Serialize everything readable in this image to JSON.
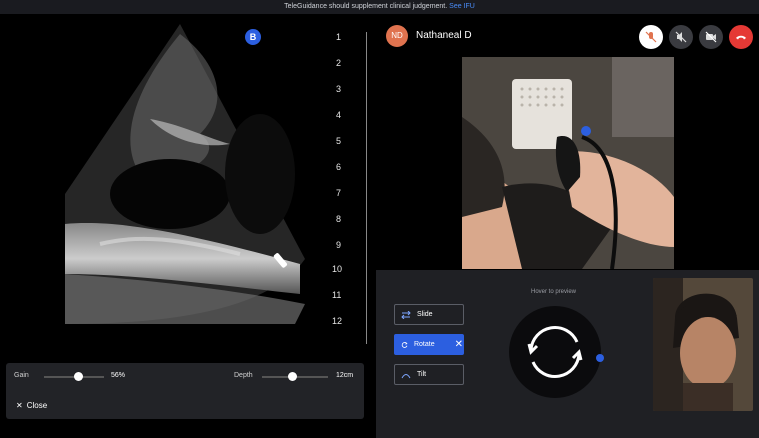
{
  "banner": {
    "text": "TeleGuidance should supplement clinical judgement.",
    "link": "See IFU"
  },
  "ultrasound": {
    "marker_label": "B",
    "depth_ticks": [
      "1",
      "2",
      "3",
      "4",
      "5",
      "6",
      "7",
      "8",
      "9",
      "10",
      "11",
      "12"
    ],
    "gain": {
      "label": "Gain",
      "value": "56%",
      "level": 0.56
    },
    "depth": {
      "label": "Depth",
      "value": "12cm",
      "level": 0.45
    },
    "close_label": "Close"
  },
  "call": {
    "avatar_initials": "ND",
    "caller_name": "Nathaneal D",
    "accent": "#2c5fe0",
    "end_color": "#e53935"
  },
  "guidance": {
    "hover_hint": "Hover to preview",
    "modes": [
      {
        "label": "Slide",
        "active": false
      },
      {
        "label": "Rotate",
        "active": true
      },
      {
        "label": "Tilt",
        "active": false
      }
    ]
  }
}
